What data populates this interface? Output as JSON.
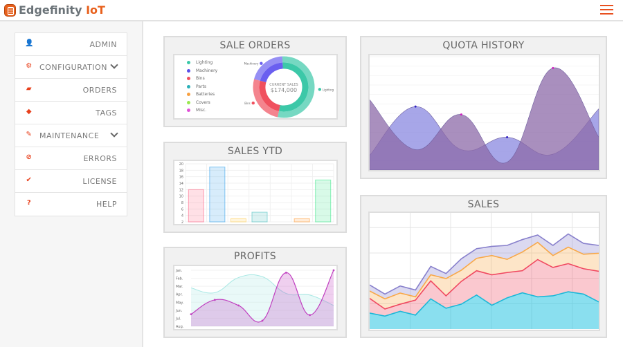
{
  "header": {
    "brand_name": "Edgefinity",
    "brand_suffix": "IoT",
    "menu_icon": "hamburger-icon",
    "accent": "#e8601c"
  },
  "sidebar": {
    "items": [
      {
        "label": "ADMIN",
        "icon": "user-icon",
        "glyph": "👤",
        "submenu": false
      },
      {
        "label": "CONFIGURATION",
        "icon": "gears-icon",
        "glyph": "⚙",
        "submenu": true
      },
      {
        "label": "ORDERS",
        "icon": "briefcase-icon",
        "glyph": "▰",
        "submenu": false
      },
      {
        "label": "TAGS",
        "icon": "tags-icon",
        "glyph": "◆",
        "submenu": false
      },
      {
        "label": "MAINTENANCE",
        "icon": "pencil-icon",
        "glyph": "✎",
        "submenu": true
      },
      {
        "label": "ERRORS",
        "icon": "ban-icon",
        "glyph": "⊘",
        "submenu": false
      },
      {
        "label": "LICENSE",
        "icon": "check-icon",
        "glyph": "✔",
        "submenu": false
      },
      {
        "label": "HELP",
        "icon": "question-icon",
        "glyph": "?",
        "submenu": false
      }
    ]
  },
  "panels": {
    "sale_orders": "SALE ORDERS",
    "sales_ytd": "SALES YTD",
    "profits": "PROFITS",
    "quota_history": "QUOTA HISTORY",
    "sales": "SALES"
  },
  "chart_data": [
    {
      "id": "sale_orders",
      "type": "pie",
      "donut": true,
      "center_label": "CURRENT SALES",
      "center_value": "$174,000",
      "legend": [
        {
          "label": "Lighting",
          "color": "#3cc8a8"
        },
        {
          "label": "Machinery",
          "color": "#5b4fe8"
        },
        {
          "label": "Bins",
          "color": "#f0505e"
        },
        {
          "label": "Parts",
          "color": "#2ab0b8"
        },
        {
          "label": "Batteries",
          "color": "#f8a040"
        },
        {
          "label": "Covers",
          "color": "#9ae850"
        },
        {
          "label": "Misc.",
          "color": "#e050d8"
        }
      ],
      "slices": [
        {
          "label": "Lighting",
          "value": 54,
          "color": "#3cc8a8"
        },
        {
          "label": "Bins",
          "value": 26,
          "color": "#f0505e"
        },
        {
          "label": "Machinery",
          "value": 20,
          "color": "#6a5ff0"
        }
      ]
    },
    {
      "id": "sales_ytd",
      "type": "bar",
      "ylim": [
        2,
        20
      ],
      "yticks": [
        2,
        4,
        6,
        8,
        10,
        12,
        14,
        16,
        18,
        20
      ],
      "values": [
        12,
        19,
        3,
        5,
        2,
        3,
        15
      ],
      "colors": [
        "#ff6384",
        "#36a2eb",
        "#ffce56",
        "#4bc0c0",
        "#9966ff",
        "#ff9f40",
        "#3ce88a"
      ]
    },
    {
      "id": "profits",
      "type": "area",
      "yticks": [
        "Jan.",
        "Feb.",
        "Mar.",
        "Apr.",
        "May.",
        "Jun.",
        "Jul.",
        "Aug."
      ],
      "series": [
        {
          "values": [
            5.5,
            3.7,
            4.4,
            6.3,
            0.3,
            5.6,
            0
          ],
          "color": "#c040c0"
        },
        {
          "values": [
            2.2,
            2.8,
            0.9,
            0.8,
            2.9,
            3.1,
            4.4
          ],
          "color": "#a8e8e4"
        }
      ]
    },
    {
      "id": "quota_history",
      "type": "area",
      "ylim": [
        0,
        100
      ],
      "series": [
        {
          "values": [
            13,
            56,
            18,
            29,
            14,
            54
          ],
          "color": "#8a88e0"
        },
        {
          "values": [
            62,
            18,
            49,
            7,
            90,
            29
          ],
          "color": "#8c6aa8"
        }
      ]
    },
    {
      "id": "sales",
      "type": "area",
      "stacked": true,
      "ylim": [
        0,
        45
      ],
      "series": [
        {
          "values": [
            6.3,
            5.1,
            7.0,
            5.5,
            11.9,
            8.2,
            9.8,
            13.4,
            9.4,
            12.3,
            14.3,
            12.7,
            13.1,
            14.7,
            13.8,
            10.7
          ],
          "color": "#1cb8d8"
        },
        {
          "values": [
            5.8,
            2.8,
            2.8,
            5.9,
            7.1,
            4.9,
            9.0,
            9.6,
            12.0,
            10.0,
            8.7,
            14.7,
            11.2,
            11.1,
            10.0,
            12.1
          ],
          "color": "#f04860"
        },
        {
          "values": [
            2.9,
            4.0,
            4.4,
            1.3,
            2.4,
            6.8,
            4.4,
            4.9,
            7.6,
            5.2,
            7.4,
            6.8,
            4.7,
            6.5,
            5.7,
            7.1
          ],
          "color": "#f8a848"
        },
        {
          "values": [
            2.4,
            1.9,
            2.8,
            2.7,
            3.3,
            2.0,
            4.5,
            3.8,
            3.6,
            5.5,
            4.9,
            2.9,
            4.0,
            5.2,
            4.3,
            3.1
          ],
          "color": "#8880cc"
        }
      ]
    }
  ]
}
